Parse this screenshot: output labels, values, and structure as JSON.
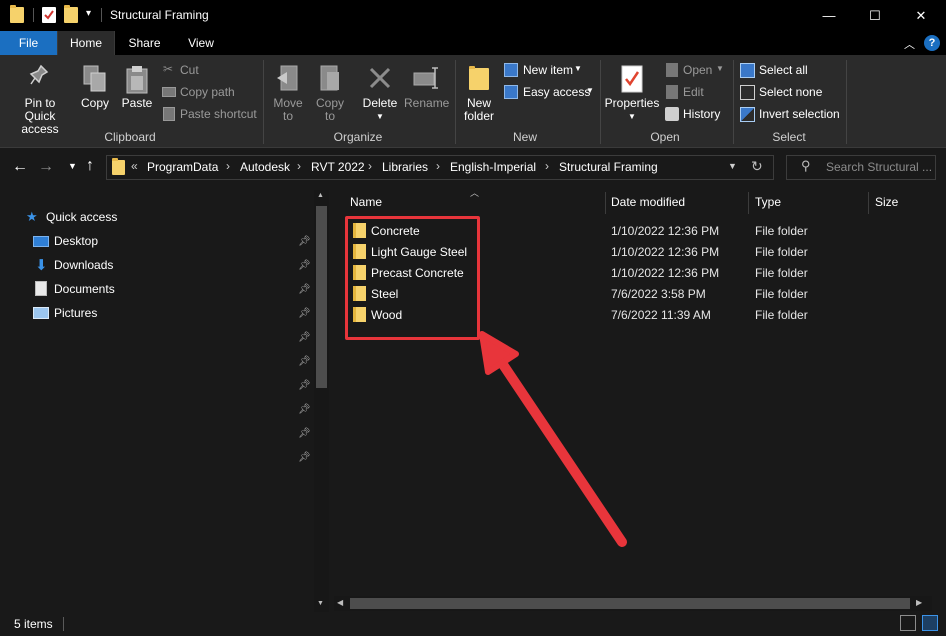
{
  "window": {
    "title": "Structural Framing",
    "minimize_glyph": "—",
    "maximize_glyph": "☐",
    "close_glyph": "✕"
  },
  "tabs": [
    "File",
    "Home",
    "Share",
    "View"
  ],
  "ribbon": {
    "clipboard": {
      "pin_label": "Pin to Quick access",
      "copy": "Copy",
      "paste": "Paste",
      "cut": "Cut",
      "copy_path": "Copy path",
      "paste_shortcut": "Paste shortcut",
      "group": "Clipboard"
    },
    "organize": {
      "move_to": "Move to",
      "copy_to": "Copy to",
      "delete": "Delete",
      "rename": "Rename",
      "group": "Organize"
    },
    "new": {
      "new_folder": "New folder",
      "new_item": "New item",
      "easy_access": "Easy access",
      "group": "New"
    },
    "open": {
      "properties": "Properties",
      "open": "Open",
      "edit": "Edit",
      "history": "History",
      "group": "Open"
    },
    "select": {
      "select_all": "Select all",
      "select_none": "Select none",
      "invert_selection": "Invert selection",
      "group": "Select"
    }
  },
  "address": {
    "breadcrumbs": [
      "ProgramData",
      "Autodesk",
      "RVT 2022",
      "Libraries",
      "English-Imperial",
      "Structural Framing"
    ],
    "search_placeholder": "Search Structural ..."
  },
  "nav_pane": {
    "quick_access": "Quick access",
    "items": [
      "Desktop",
      "Downloads",
      "Documents",
      "Pictures"
    ]
  },
  "columns": [
    "Name",
    "Date modified",
    "Type",
    "Size"
  ],
  "files": [
    {
      "name": "Concrete",
      "date": "1/10/2022 12:36 PM",
      "type": "File folder"
    },
    {
      "name": "Light Gauge Steel",
      "date": "1/10/2022 12:36 PM",
      "type": "File folder"
    },
    {
      "name": "Precast Concrete",
      "date": "1/10/2022 12:36 PM",
      "type": "File folder"
    },
    {
      "name": "Steel",
      "date": "7/6/2022 3:58 PM",
      "type": "File folder"
    },
    {
      "name": "Wood",
      "date": "7/6/2022 11:39 AM",
      "type": "File folder"
    }
  ],
  "status": {
    "item_count": "5 items"
  },
  "colors": {
    "highlight_box": "#e8353b",
    "arrow": "#e8353b",
    "file_tab": "#1b6fc1",
    "folder": "#f6d26b"
  }
}
